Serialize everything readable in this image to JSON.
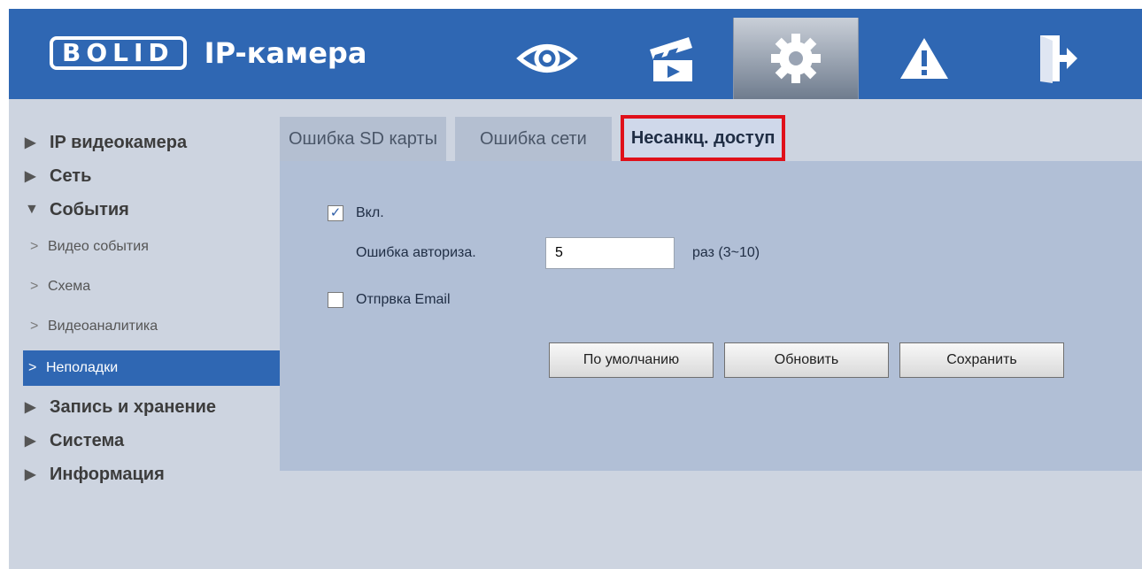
{
  "header": {
    "logo_brand": "BOLID",
    "logo_text": "IP-камера",
    "nav": [
      {
        "icon": "eye-icon",
        "label": "live"
      },
      {
        "icon": "clapperboard-icon",
        "label": "playback"
      },
      {
        "icon": "gear-icon",
        "label": "settings"
      },
      {
        "icon": "warning-icon",
        "label": "alarm"
      },
      {
        "icon": "logout-icon",
        "label": "logout"
      }
    ],
    "colors": {
      "header_bg": "#2f67b3",
      "active_bg": "#8a96a8"
    }
  },
  "sidebar": {
    "items": [
      {
        "label": "IP видеокамера",
        "arrow": "▶"
      },
      {
        "label": "Сеть",
        "arrow": "▶"
      },
      {
        "label": "События",
        "arrow": "▼"
      },
      {
        "label": "Видео события"
      },
      {
        "label": "Схема"
      },
      {
        "label": "Видеоаналитика"
      },
      {
        "label": "Неполадки"
      },
      {
        "label": "Запись и хранение",
        "arrow": "▶"
      },
      {
        "label": "Система",
        "arrow": "▶"
      },
      {
        "label": "Информация",
        "arrow": "▶"
      }
    ],
    "sub_chevron": ">"
  },
  "tabs": [
    {
      "label": "Ошибка SD карты"
    },
    {
      "label": "Ошибка сети"
    },
    {
      "label": "Несанкц. доступ"
    }
  ],
  "form": {
    "enable_label": "Вкл.",
    "enable_checked": "✓",
    "auth_label": "Ошибка авториза.",
    "auth_value": "5",
    "auth_hint": "раз (3~10)",
    "email_label": "Отпрвка Email"
  },
  "buttons": {
    "default": "По умолчанию",
    "refresh": "Обновить",
    "save": "Сохранить"
  }
}
